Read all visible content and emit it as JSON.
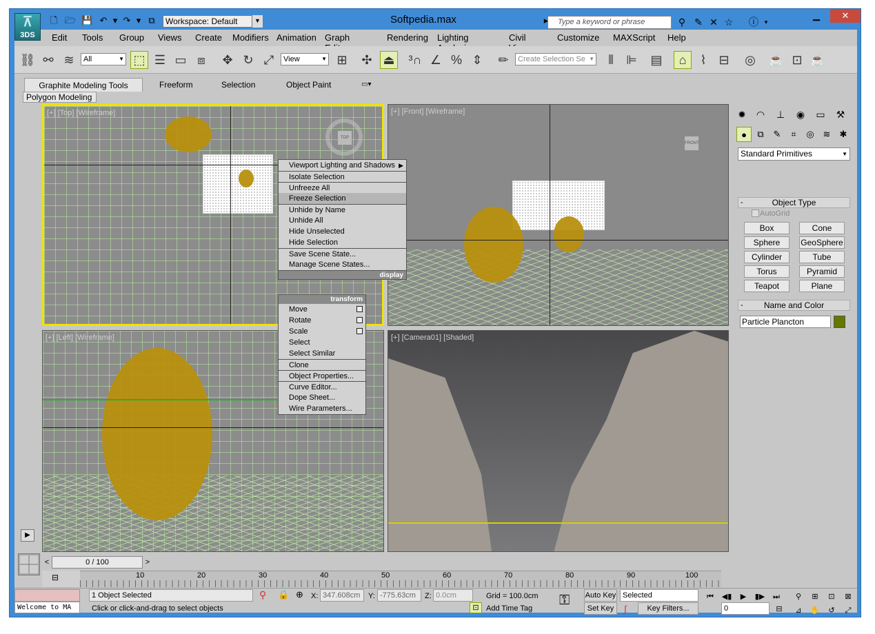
{
  "window": {
    "title": "Softpedia.max",
    "logo_text": "3DS",
    "workspace": "Workspace: Default",
    "search_placeholder": "Type a keyword or phrase"
  },
  "menu": [
    "Edit",
    "Tools",
    "Group",
    "Views",
    "Create",
    "Modifiers",
    "Animation",
    "Graph Editors",
    "Rendering",
    "Lighting Analysis",
    "Civil View",
    "Customize",
    "MAXScript",
    "Help"
  ],
  "toolbar": {
    "filter_dropdown": "All",
    "ref_coord_dropdown": "View",
    "selection_set_placeholder": "Create Selection Se"
  },
  "ribbon": {
    "tabs": [
      "Graphite Modeling Tools",
      "Freeform",
      "Selection",
      "Object Paint"
    ],
    "panel": "Polygon Modeling"
  },
  "viewports": {
    "top": "[+] [Top] [Wireframe]",
    "front": "[+] [Front] [Wireframe]",
    "left": "[+] [Left] [Wireframe]",
    "camera": "[+] [Camera01] [Shaded]",
    "viewcube_top": "TOP",
    "viewcube_front": "FRONT"
  },
  "quad_menu": {
    "display_items": [
      "Viewport Lighting and Shadows",
      "Isolate Selection",
      "Unfreeze All",
      "Freeze Selection",
      "Unhide by Name",
      "Unhide All",
      "Hide Unselected",
      "Hide Selection",
      "Save Scene State...",
      "Manage Scene States..."
    ],
    "display_header": "display",
    "transform_header": "transform",
    "transform_items": [
      "Move",
      "Rotate",
      "Scale",
      "Select",
      "Select Similar",
      "Clone",
      "Object Properties...",
      "Curve Editor...",
      "Dope Sheet...",
      "Wire Parameters..."
    ]
  },
  "command_panel": {
    "category_dropdown": "Standard Primitives",
    "object_type_title": "Object Type",
    "autogrid": "AutoGrid",
    "primitives": [
      "Box",
      "Cone",
      "Sphere",
      "GeoSphere",
      "Cylinder",
      "Tube",
      "Torus",
      "Pyramid",
      "Teapot",
      "Plane"
    ],
    "name_color_title": "Name and Color",
    "object_name": "Particle Plancton",
    "object_color": "#667700"
  },
  "timeline": {
    "slider": "0 / 100",
    "ticks": [
      "10",
      "20",
      "30",
      "40",
      "50",
      "60",
      "70",
      "80",
      "90",
      "100"
    ]
  },
  "status": {
    "welcome": "Welcome to MA",
    "selection": "1 Object Selected",
    "prompt": "Click or click-and-drag to select objects",
    "x_label": "X:",
    "x_value": "347.608cm",
    "y_label": "Y:",
    "y_value": "-775.63cm",
    "z_label": "Z:",
    "z_value": "0.0cm",
    "grid": "Grid = 100.0cm",
    "add_time_tag": "Add Time Tag",
    "auto_key": "Auto Key",
    "set_key": "Set Key",
    "selected_dropdown": "Selected",
    "key_filters": "Key Filters...",
    "frame": "0"
  }
}
